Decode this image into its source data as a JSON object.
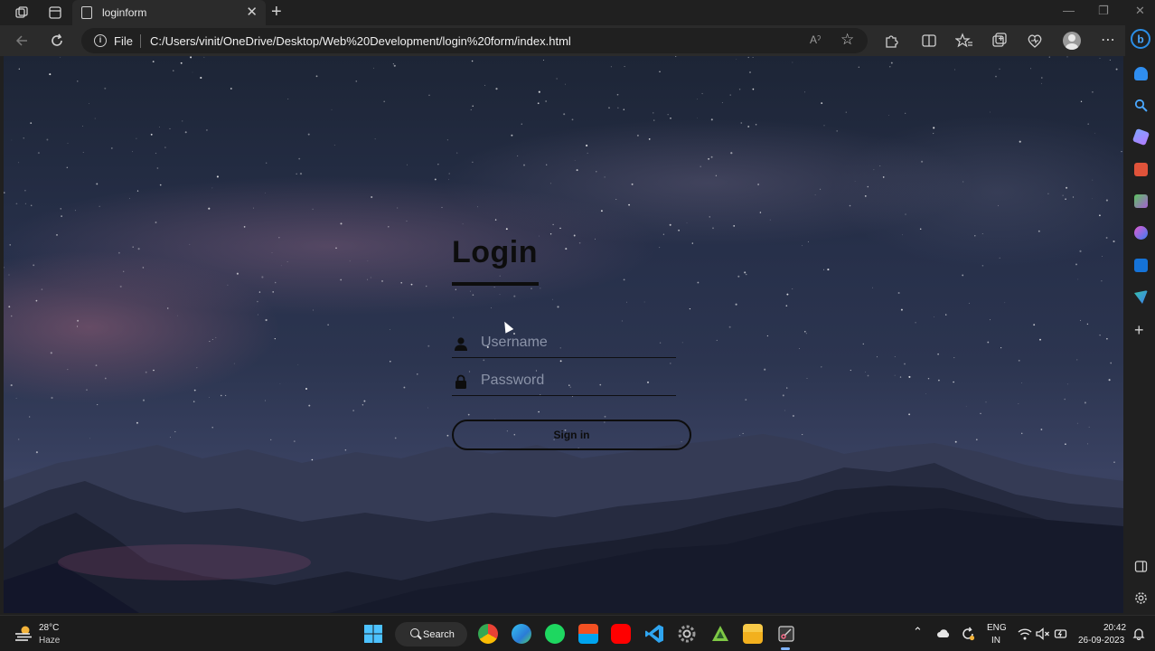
{
  "browser": {
    "tab_title": "loginform",
    "tab_close": "✕",
    "new_tab": "+",
    "address_prefix": "File",
    "address_url": "C:/Users/vinit/OneDrive/Desktop/Web%20Development/login%20form/index.html",
    "read_aloud": "Aˀ",
    "window_controls": [
      "—",
      "❐",
      "✕"
    ]
  },
  "page": {
    "heading": "Login",
    "username_placeholder": "Username",
    "password_placeholder": "Password",
    "signin_label": "Sign in"
  },
  "taskbar": {
    "temperature": "28°C",
    "weather": "Haze",
    "search_label": "Search",
    "language_line1": "ENG",
    "language_line2": "IN",
    "time": "20:42",
    "date": "26-09-2023"
  },
  "colors": {
    "sky_top": "#1d2536",
    "sky_mid": "#2c3550",
    "form_text": "#0d0d0d",
    "placeholder": "#8b93a8",
    "edge_accent": "#2b8ee6"
  }
}
